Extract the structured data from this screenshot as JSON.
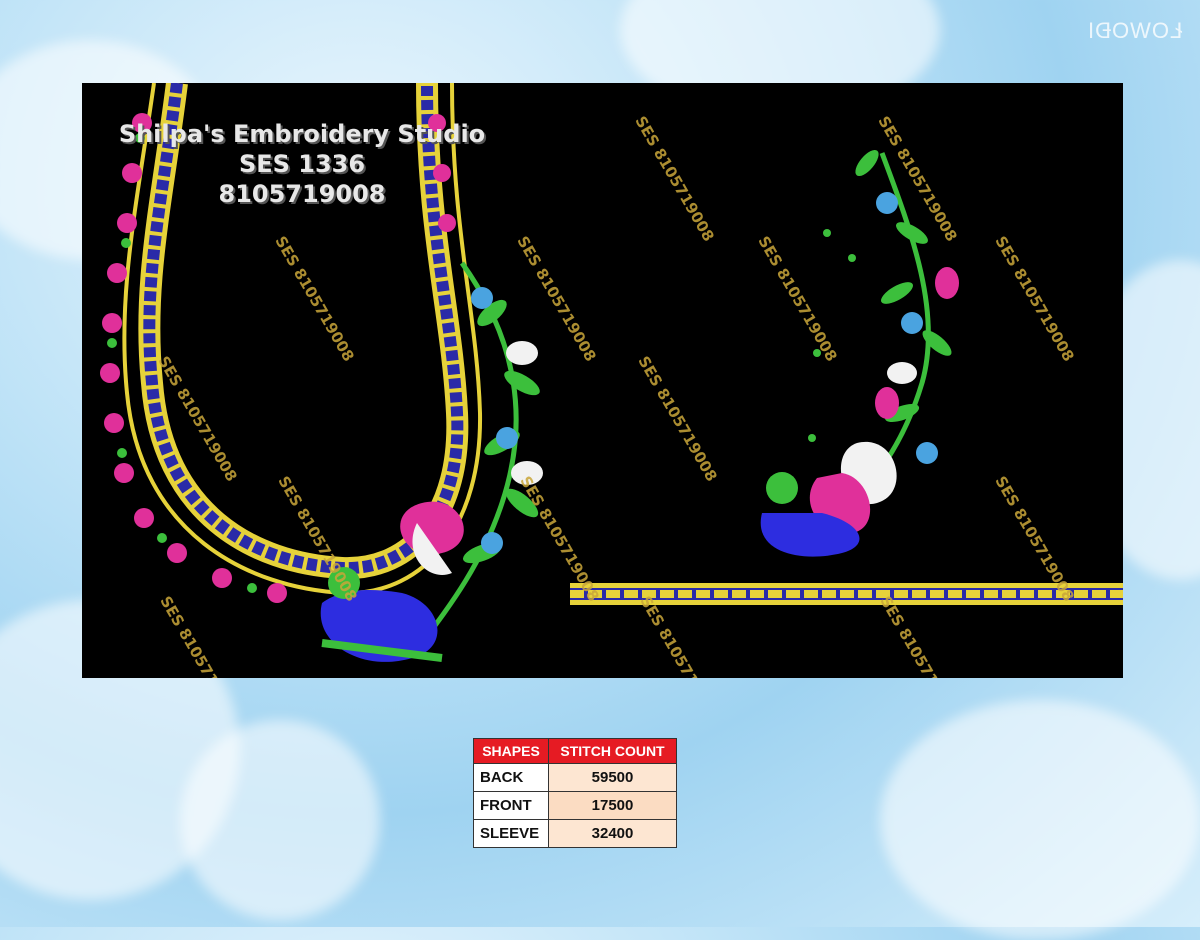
{
  "corner_mark": "ŁOWOĐI",
  "design": {
    "studio_name": "Shilpa's Embroidery Studio",
    "design_code": "SES 1336",
    "phone": "8105719008"
  },
  "watermark": "SES 8105719008",
  "stitch_table": {
    "headers": [
      "SHAPES",
      "STITCH COUNT"
    ],
    "rows": [
      {
        "shape": "BACK",
        "count": "59500"
      },
      {
        "shape": "FRONT",
        "count": "17500"
      },
      {
        "shape": "SLEEVE",
        "count": "32400"
      }
    ],
    "header_color": "#e61b23",
    "cell_color": "#fde6d2"
  }
}
